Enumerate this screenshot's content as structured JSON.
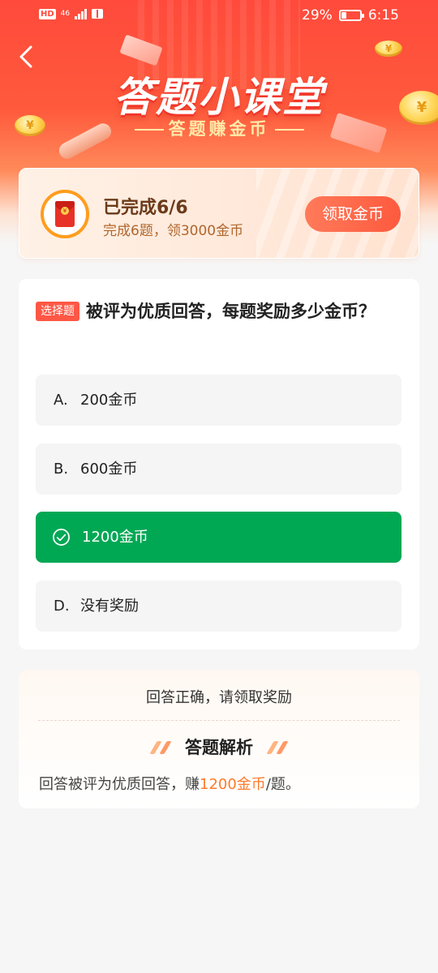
{
  "status_bar": {
    "left_badge": "HD",
    "network": "46",
    "battery_percent": "29%",
    "battery_level": 0.29,
    "time": "6:15"
  },
  "header": {
    "title": "答题小课堂",
    "subtitle": "答题赚金币",
    "back_icon": "chevron-left-icon"
  },
  "reward": {
    "title": "已完成6/6",
    "description": "完成6题，领3000金币",
    "button_label": "领取金币",
    "icon": "red-packet-icon",
    "coin_symbol": "¥"
  },
  "question": {
    "tag": "选择题",
    "text": "被评为优质回答，每题奖励多少金币？",
    "options": [
      {
        "letter": "A.",
        "text": "200金币",
        "state": "normal"
      },
      {
        "letter": "B.",
        "text": "600金币",
        "state": "normal"
      },
      {
        "letter": "",
        "text": "1200金币",
        "state": "correct"
      },
      {
        "letter": "D.",
        "text": "没有奖励",
        "state": "normal"
      }
    ]
  },
  "analysis": {
    "result": "回答正确，请领取奖励",
    "heading": "答题解析",
    "text_before": "回答被评为优质回答，赚",
    "text_highlight": "1200金币",
    "text_after": "/题。"
  },
  "colors": {
    "primary_red": "#ff4a3c",
    "correct_green": "#00a854",
    "highlight_orange": "#ff7a2a"
  }
}
